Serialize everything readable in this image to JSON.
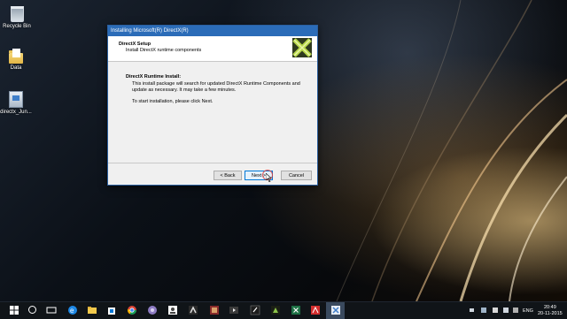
{
  "desktop": {
    "icons": [
      {
        "label": "Recycle Bin"
      },
      {
        "label": "Data"
      },
      {
        "label": "directx_Jun..."
      }
    ]
  },
  "dialog": {
    "title": "Installing Microsoft(R) DirectX(R)",
    "header_title": "DirectX Setup",
    "header_subtitle": "Install DirectX runtime components",
    "section_title": "DirectX Runtime Install:",
    "description": "This install package will search for updated DirectX Runtime Components and update as necessary. It may take a few minutes.",
    "hint": "To start installation, please click Next.",
    "buttons": {
      "back": "< Back",
      "next": "Next >",
      "cancel": "Cancel"
    }
  },
  "taskbar": {
    "apps": [
      "start-icon",
      "search-icon",
      "task-view-icon",
      "edge-icon",
      "explorer-icon",
      "store-icon",
      "chrome-icon",
      "media-icon",
      "people-icon",
      "game-icon",
      "app-icon",
      "video-icon",
      "music-icon",
      "green-app-icon",
      "excel-icon",
      "acrobat-icon",
      "directx-setup-icon"
    ],
    "language": "ENG",
    "time": "20:49",
    "date": "20-11-2015"
  },
  "colors": {
    "titlebar": "#2b6cb8",
    "accent": "#0078d7",
    "taskbar": "#101418"
  }
}
